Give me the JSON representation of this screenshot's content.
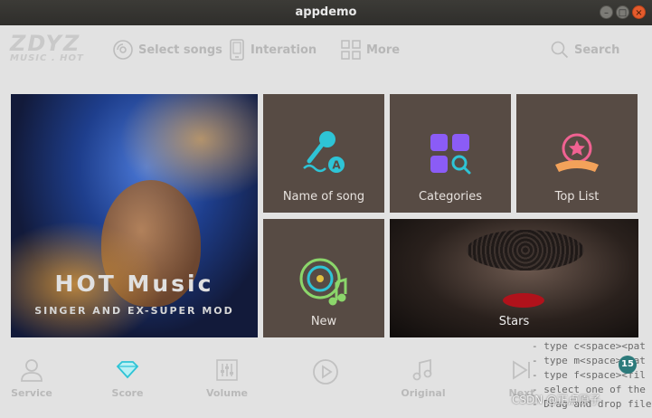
{
  "window": {
    "title": "appdemo",
    "minimize_glyph": "–",
    "maximize_glyph": "□",
    "close_glyph": "×"
  },
  "logo": {
    "big": "ZDYZ",
    "small": "MUSIC . HOT"
  },
  "nav": {
    "select_songs": "Select songs",
    "interaction": "Interation",
    "more": "More",
    "search": "Search"
  },
  "hero": {
    "title": "HOT Music",
    "subtitle": "SINGER AND EX-SUPER MOD"
  },
  "tiles": {
    "name_of_song": "Name of song",
    "categories": "Categories",
    "top_list": "Top List",
    "new": "New",
    "stars": "Stars"
  },
  "bottom": {
    "service": "Service",
    "score": "Score",
    "volume": "Volume",
    "original": "Original",
    "next": "Next"
  },
  "overlay": {
    "lines": [
      "- type c<space><pat",
      "- type m<space><pat",
      "- type f<space><fil",
      "- select one of the othe",
      "- Drag and drop files here"
    ],
    "badge": "15",
    "watermark": "CSDN @正点原子"
  },
  "colors": {
    "tile_bg": "#574b44",
    "accent_teal": "#2ec4d6",
    "accent_purple": "#8b5cf6",
    "accent_pink": "#f06292"
  }
}
